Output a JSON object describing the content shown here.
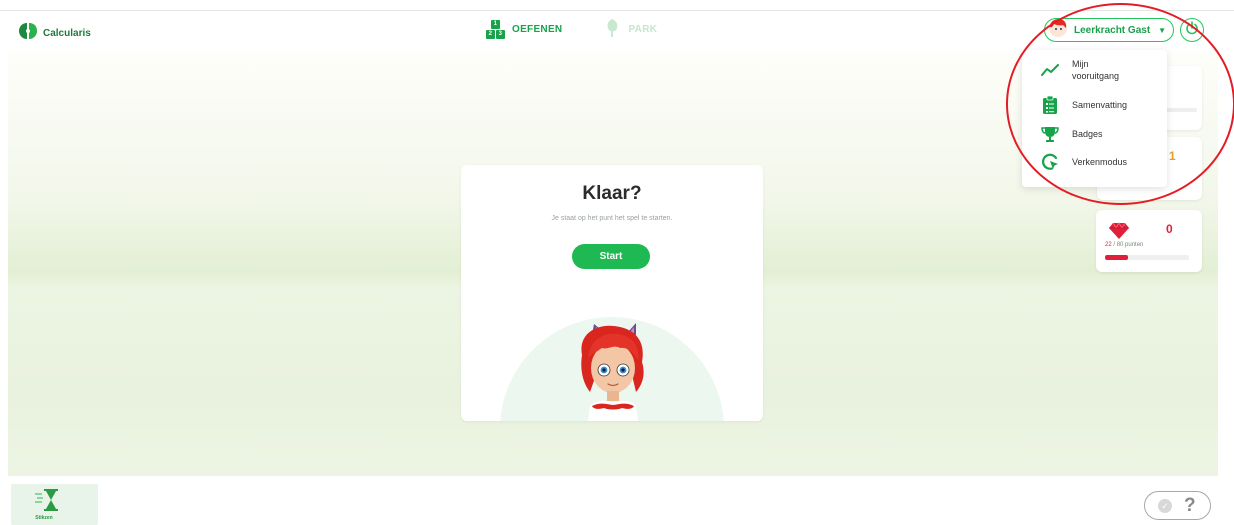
{
  "app": {
    "brand": "Calcularis"
  },
  "nav": {
    "practice_label": "OEFENEN",
    "practice_block_digits": [
      "1",
      "2",
      "3"
    ],
    "park_label": "PARK"
  },
  "user": {
    "name": "Leerkracht Gast"
  },
  "menu": {
    "items": [
      {
        "label": "Mijn vooruitgang",
        "icon": "progress-chart-icon"
      },
      {
        "label": "Samenvatting",
        "icon": "clipboard-icon"
      },
      {
        "label": "Badges",
        "icon": "trophy-icon"
      },
      {
        "label": "Verkenmodus",
        "icon": "explore-cursor-icon"
      }
    ]
  },
  "card": {
    "title": "Klaar?",
    "subtitle": "Je staat op het punt het spel te starten.",
    "start_label": "Start"
  },
  "scores": {
    "coins_partial": "1",
    "gems": "0",
    "points_current": "22",
    "points_rest": "/ 80 punten",
    "points_fraction": 0.275
  },
  "bottom": {
    "stikzen_label": "Stikzen",
    "help_label": "?"
  },
  "colors": {
    "brand_green": "#17a34a",
    "accent_red": "#e0203a",
    "coin_orange": "#e7a41a",
    "annotation_red": "#e51c24"
  }
}
